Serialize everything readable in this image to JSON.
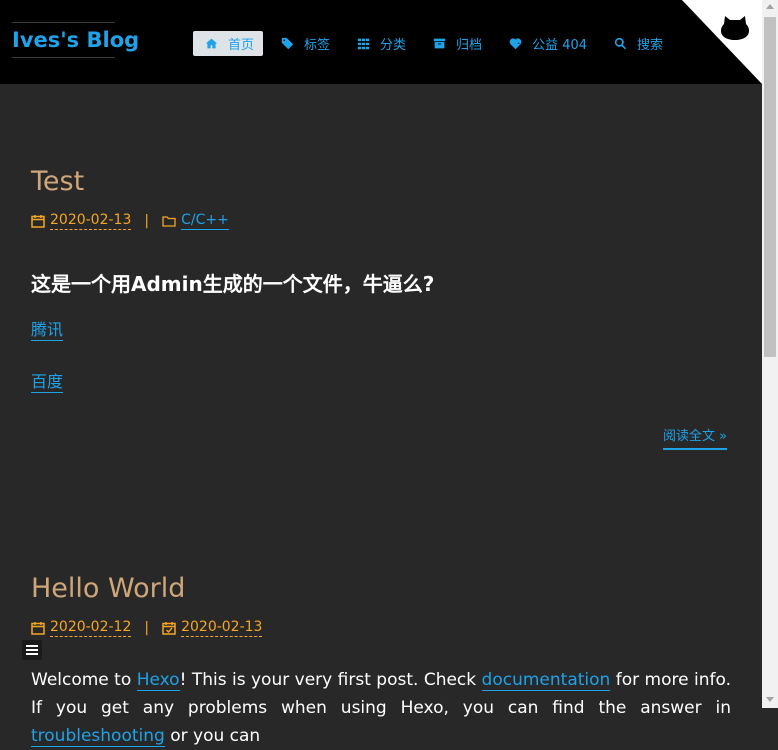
{
  "blog": {
    "title": "Ives's Blog"
  },
  "nav": {
    "items": [
      {
        "label": "首页",
        "icon": "home-icon"
      },
      {
        "label": "标签",
        "icon": "tag-icon"
      },
      {
        "label": "分类",
        "icon": "grid-icon"
      },
      {
        "label": "归档",
        "icon": "archive-icon"
      },
      {
        "label": "公益 404",
        "icon": "heartbeat-icon"
      },
      {
        "label": "搜索",
        "icon": "search-icon"
      }
    ],
    "active_index": 0
  },
  "corner": {
    "icon": "github-octocat-icon"
  },
  "posts": [
    {
      "title": "Test",
      "date": "2020-02-13",
      "separator": "|",
      "category": "C/C++",
      "heading": "这是一个用Admin生成的一个文件，牛逼么?",
      "links": [
        "腾讯",
        "百度"
      ],
      "read_more": "阅读全文 »"
    },
    {
      "title": "Hello World",
      "date": "2020-02-12",
      "separator": "|",
      "updated": "2020-02-13",
      "intro": {
        "t1": "Welcome to ",
        "l1": "Hexo",
        "t2": "! This is your very first post. Check ",
        "l2": "documentation",
        "t3": " for more info. If you get any problems when using Hexo, you can find the answer in ",
        "l3": "troubleshooting",
        "t4": " or you can"
      }
    }
  ],
  "colors": {
    "background": "#282828",
    "header": "#000000",
    "accent": "#1fa2e8",
    "title": "#cfa67a",
    "meta": "#f5a623"
  }
}
